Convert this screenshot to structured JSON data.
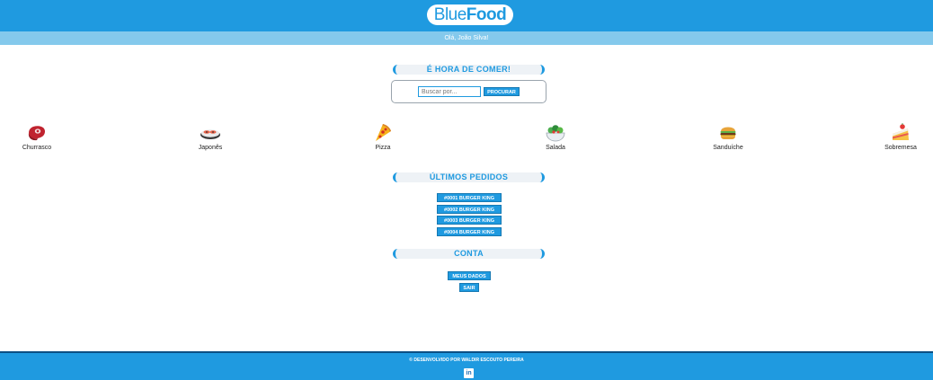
{
  "header": {
    "logo_part1": "Blue",
    "logo_part2": "Food"
  },
  "greeting": "Olá, João Silva!",
  "search": {
    "title": "É HORA DE COMER!",
    "placeholder": "Buscar por...",
    "button_label": "PROCURAR"
  },
  "categories": [
    {
      "label": "Churrasco",
      "icon": "steak-icon"
    },
    {
      "label": "Japonês",
      "icon": "sushi-icon"
    },
    {
      "label": "Pizza",
      "icon": "pizza-icon"
    },
    {
      "label": "Salada",
      "icon": "salad-icon"
    },
    {
      "label": "Sanduíche",
      "icon": "burger-icon"
    },
    {
      "label": "Sobremesa",
      "icon": "cake-icon"
    }
  ],
  "orders": {
    "title": "ÚLTIMOS PEDIDOS",
    "items": [
      "#0001 BURGER KING",
      "#0002 BURGER KING",
      "#0003 BURGER KING",
      "#0004 BURGER KING"
    ]
  },
  "account": {
    "title": "CONTA",
    "my_data_label": "MEUS DADOS",
    "logout_label": "SAIR"
  },
  "footer": {
    "credit": "© DESENVOLVIDO POR WALDIR ESCOUTO PEREIRA",
    "linkedin_label": "in"
  },
  "colors": {
    "primary": "#1f9ae0",
    "light": "#84c9ec",
    "footer_border": "#0b4f84"
  }
}
